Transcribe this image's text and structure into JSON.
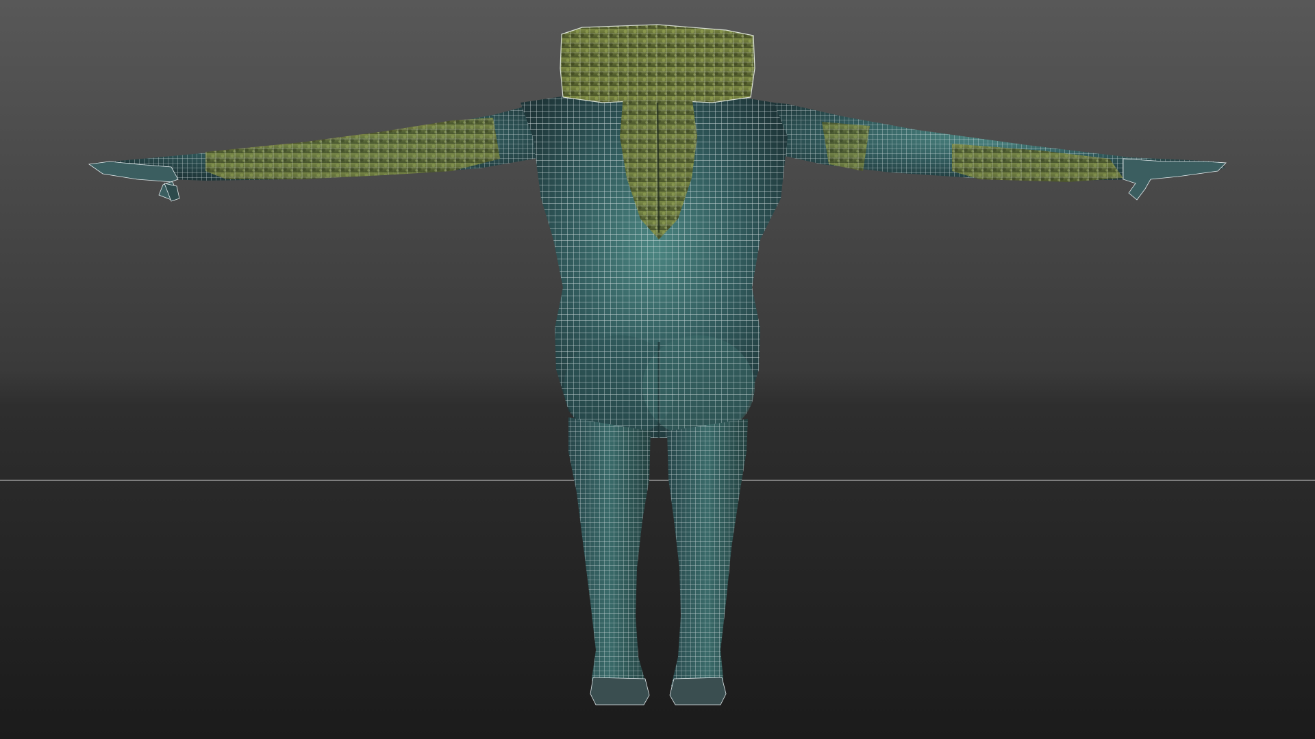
{
  "scene": {
    "background_top": "#5a5a5a",
    "background_bottom": "#1c1c1c",
    "floor_line_color": "#9a9a9a",
    "wireframe_color": "#e8eef0",
    "skin_color": "#2f5b5c",
    "skin_highlight": "#4d8a86",
    "moss_color": "#5e6b32",
    "moss_highlight": "#8a9a4a",
    "model": "t-pose-character-back-view",
    "display_mode": "wireframe-over-shaded"
  }
}
